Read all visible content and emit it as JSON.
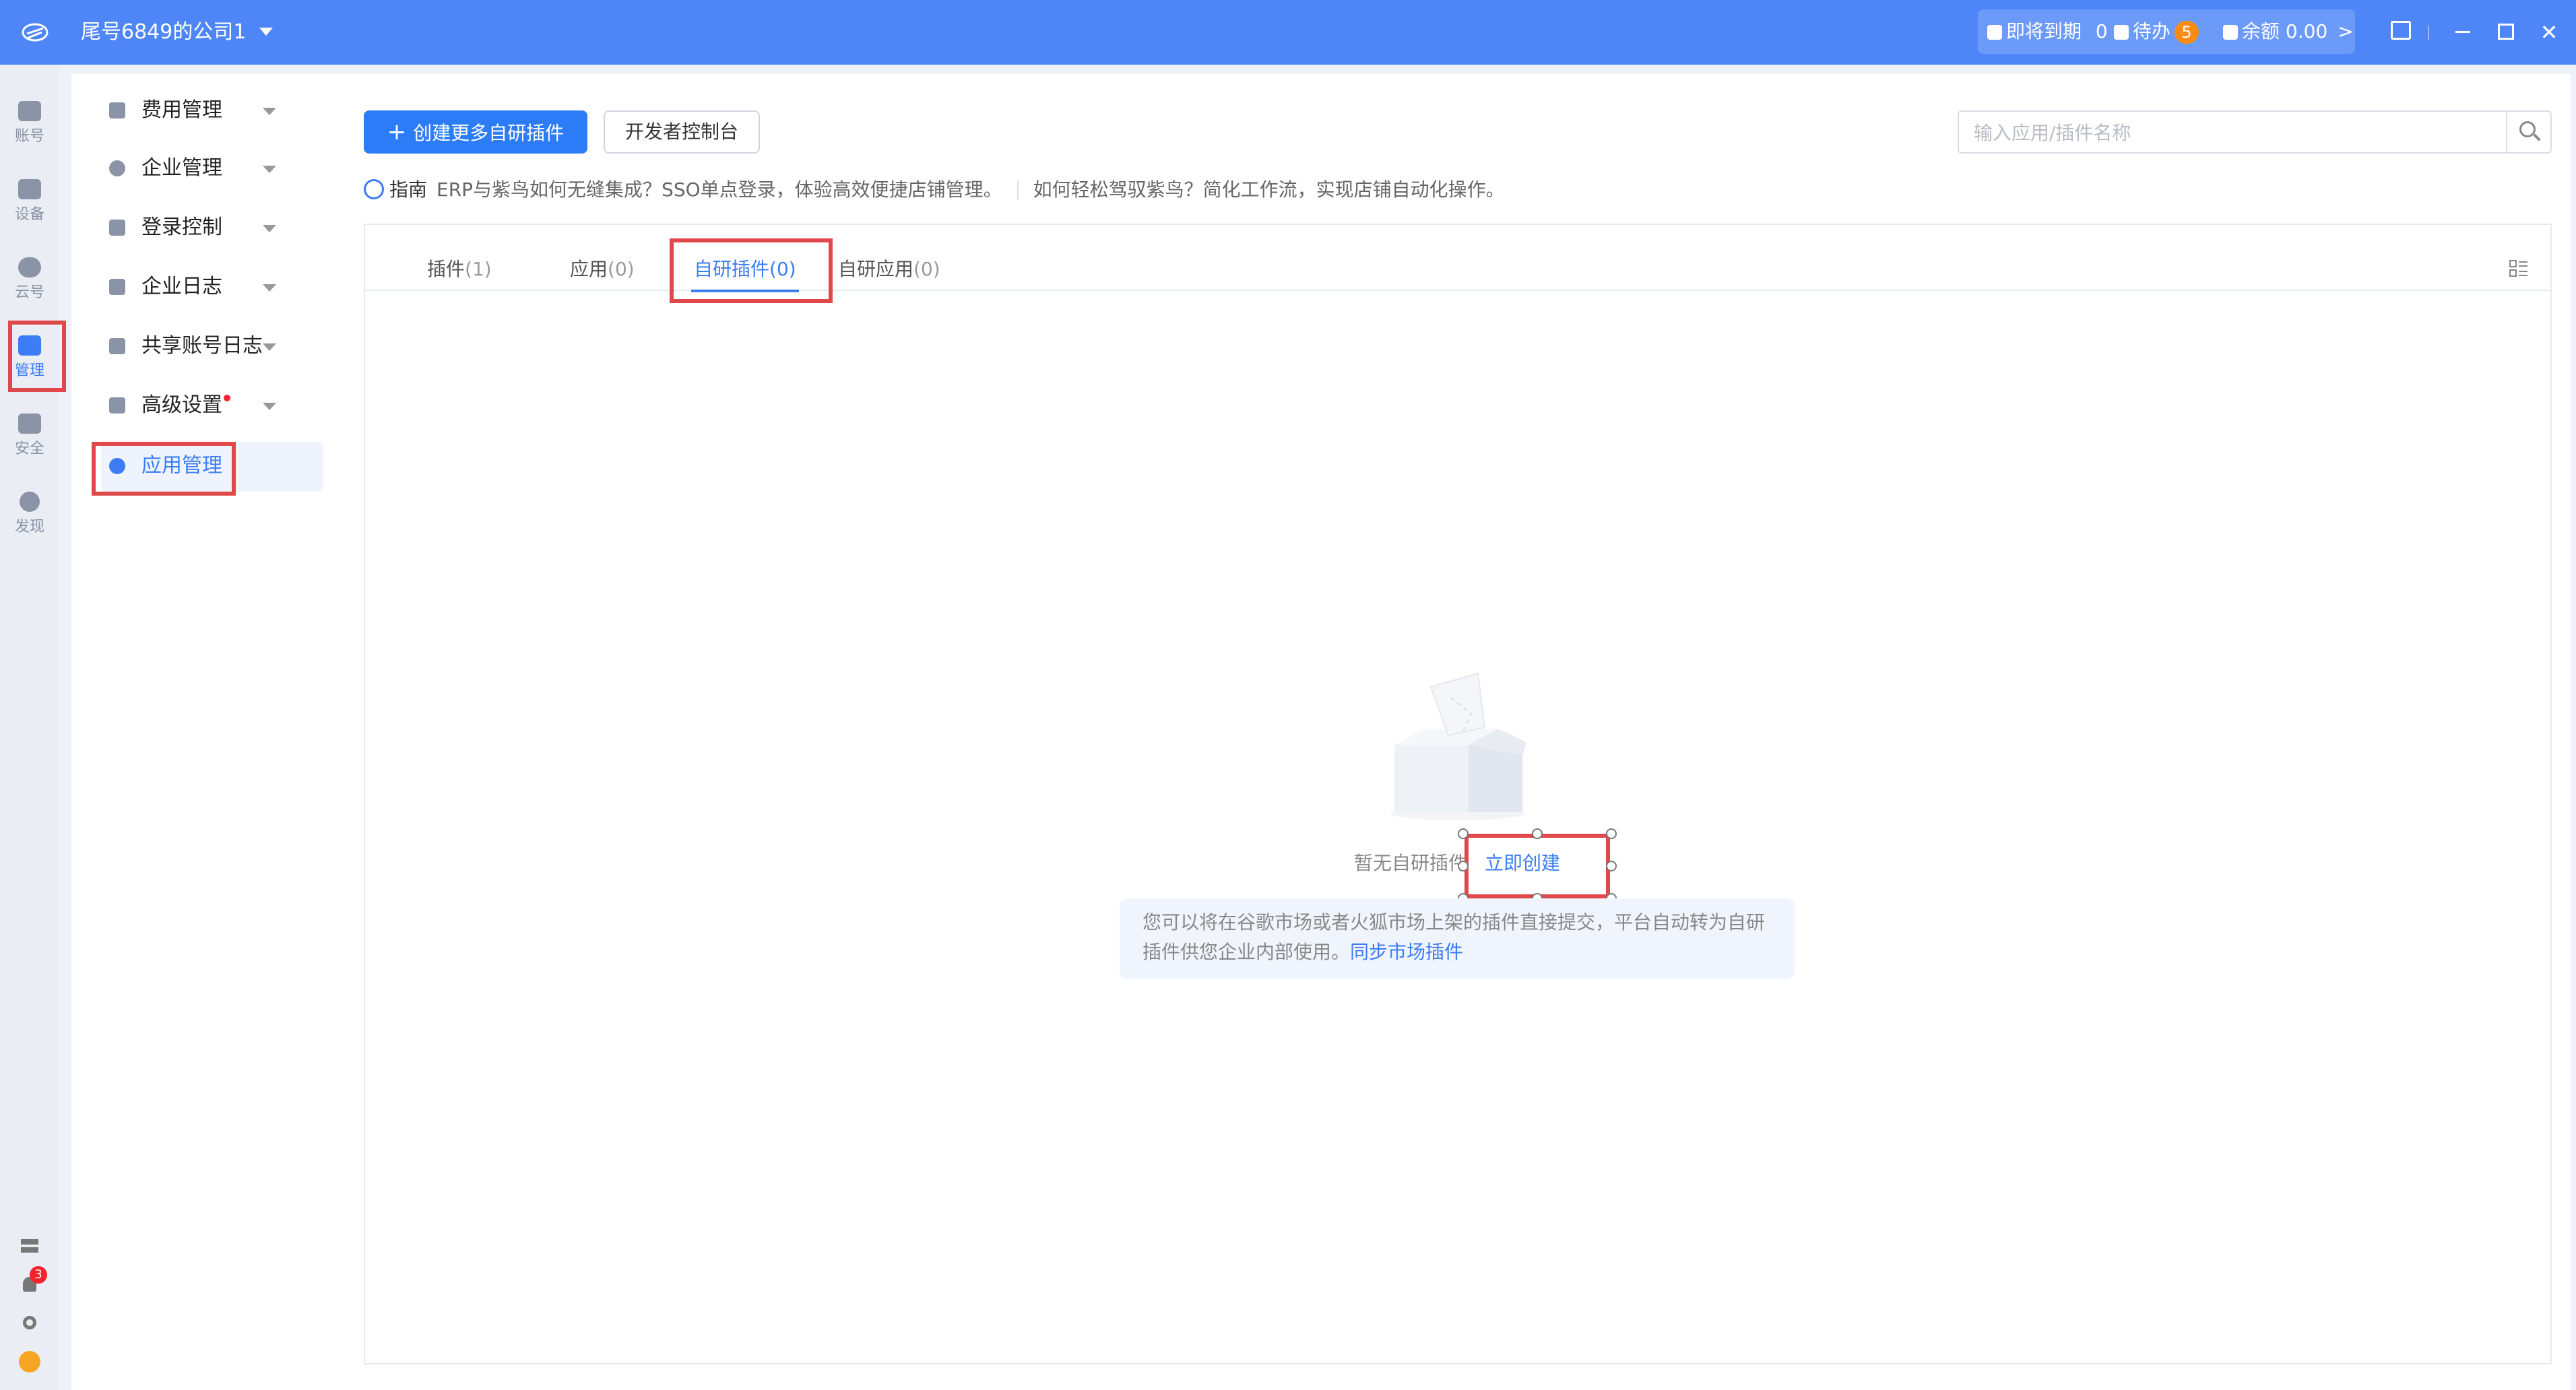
{
  "topbar": {
    "company": "尾号6849的公司1",
    "expiring_label": "即将到期",
    "expiring_count": "0",
    "todo_label": "待办",
    "todo_count": "5",
    "balance_label": "余额",
    "balance_value": "0.00",
    "chevron": ">"
  },
  "rail": {
    "items": [
      {
        "label": "账号",
        "icon": "account-icon"
      },
      {
        "label": "设备",
        "icon": "device-icon"
      },
      {
        "label": "云号",
        "icon": "cloud-icon"
      },
      {
        "label": "管理",
        "icon": "manage-icon"
      },
      {
        "label": "安全",
        "icon": "security-icon"
      },
      {
        "label": "发现",
        "icon": "discover-icon"
      }
    ],
    "active": "管理",
    "notification_count": "3"
  },
  "menu": {
    "items": [
      {
        "label": "费用管理"
      },
      {
        "label": "企业管理"
      },
      {
        "label": "登录控制"
      },
      {
        "label": "企业日志"
      },
      {
        "label": "共享账号日志"
      },
      {
        "label": "高级设置"
      },
      {
        "label": "应用管理"
      }
    ],
    "active": "应用管理"
  },
  "toolbar": {
    "create_label": "创建更多自研插件",
    "dev_console_label": "开发者控制台",
    "search_placeholder": "输入应用/插件名称"
  },
  "guide": {
    "title": "指南",
    "link1": "ERP与紫鸟如何无缝集成？SSO单点登录，体验高效便捷店铺管理。",
    "link2": "如何轻松驾驭紫鸟？简化工作流，实现店铺自动化操作。"
  },
  "tabs": [
    {
      "label": "插件",
      "count": "(1)"
    },
    {
      "label": "应用",
      "count": "(0)"
    },
    {
      "label": "自研插件",
      "count": "(0)"
    },
    {
      "label": "自研应用",
      "count": "(0)"
    }
  ],
  "active_tab": "自研插件",
  "empty": {
    "text": "暂无自研插件",
    "create_link": "立即创建",
    "notice": "您可以将在谷歌市场或者火狐市场上架的插件直接提交，平台自动转为自研插件供您企业内部使用。",
    "sync_link": "同步市场插件"
  },
  "colors": {
    "topbar": "#4f86f7",
    "accent": "#3c7df5",
    "highlight_box": "#e0494b",
    "badge": "#fa8c16"
  }
}
